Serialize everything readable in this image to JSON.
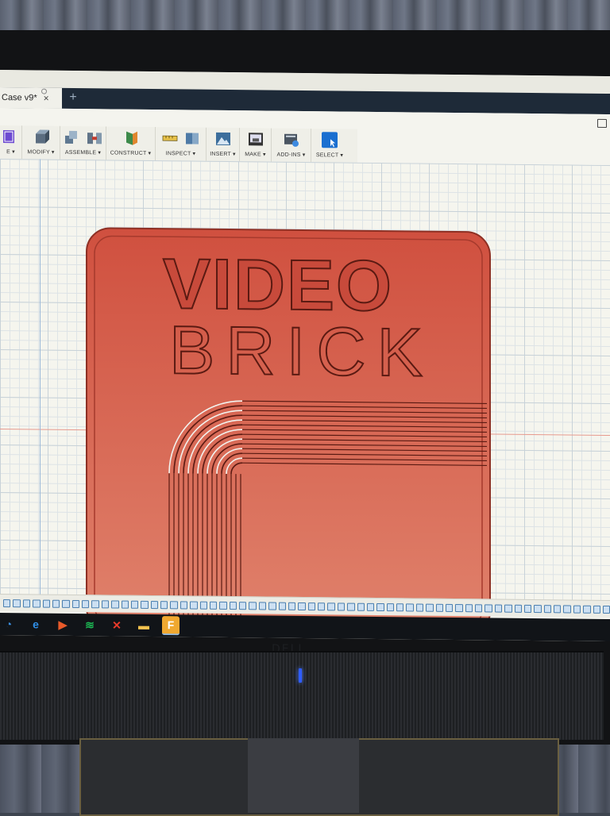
{
  "window": {
    "doc_tab_title": "Case v9*",
    "close_glyph": "×",
    "new_tab_glyph": "+"
  },
  "toolbar": {
    "groups": [
      {
        "label": "E ▾"
      },
      {
        "label": "MODIFY ▾"
      },
      {
        "label": "ASSEMBLE ▾"
      },
      {
        "label": "CONSTRUCT ▾"
      },
      {
        "label": "INSPECT ▾"
      },
      {
        "label": "INSERT ▾"
      },
      {
        "label": "MAKE ▾"
      },
      {
        "label": "ADD-INS ▾"
      },
      {
        "label": "SELECT ▾"
      }
    ]
  },
  "model": {
    "line1": "VIDEO",
    "line2": "BRICK",
    "body_color": "#d9584a",
    "accent_color": "#1a6fd0"
  },
  "taskbar": {
    "icons": [
      "search-icon",
      "edge-icon",
      "media-player-icon",
      "spotify-icon",
      "xmind-icon",
      "file-explorer-icon",
      "fusion-icon"
    ]
  },
  "monitor": {
    "brand": "DELL"
  }
}
